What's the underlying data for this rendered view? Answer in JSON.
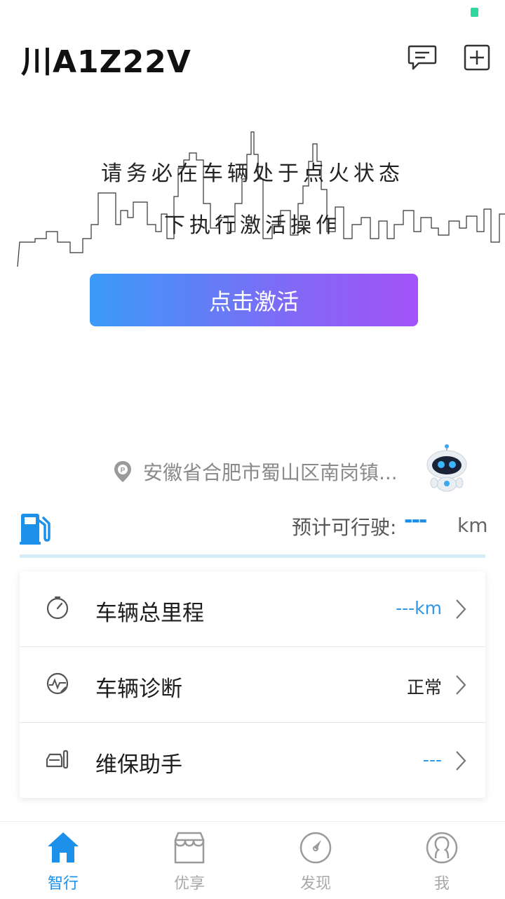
{
  "header": {
    "plate": "川A1Z22V",
    "icons": [
      "message-icon",
      "add-icon"
    ]
  },
  "activation": {
    "notice_line1": "请务必在车辆处于点火状态",
    "notice_line2": "下执行激活操作",
    "button_label": "点击激活"
  },
  "location": {
    "address": "安徽省合肥市蜀山区南岗镇..."
  },
  "range": {
    "label": "预计可行驶:",
    "value": "---",
    "unit": "km"
  },
  "menu": {
    "items": [
      {
        "label": "车辆总里程",
        "value": "---km",
        "icon": "odometer-icon"
      },
      {
        "label": "车辆诊断",
        "value": "正常",
        "icon": "diagnosis-icon"
      },
      {
        "label": "维保助手",
        "value": "---",
        "icon": "maintenance-icon"
      }
    ]
  },
  "tabbar": {
    "tabs": [
      {
        "label": "智行",
        "icon": "home-icon",
        "active": true
      },
      {
        "label": "优享",
        "icon": "store-icon",
        "active": false
      },
      {
        "label": "发现",
        "icon": "compass-icon",
        "active": false
      },
      {
        "label": "我",
        "icon": "profile-icon",
        "active": false
      }
    ]
  },
  "colors": {
    "accent_blue": "#1d90ea",
    "gradient_start": "#3a9bf8",
    "gradient_end": "#a453f9",
    "status_green": "#2fd6a0"
  }
}
